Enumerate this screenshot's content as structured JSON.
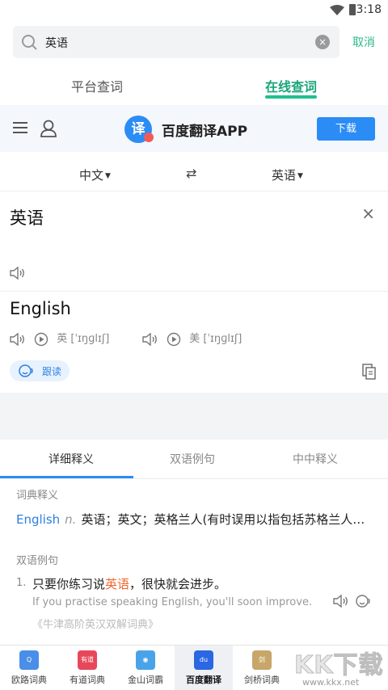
{
  "status_bar": {
    "time": "3:18"
  },
  "search": {
    "query": "英语",
    "cancel_label": "取消"
  },
  "top_tabs": [
    {
      "label": "平台查词",
      "active": false
    },
    {
      "label": "在线查词",
      "active": true
    }
  ],
  "app_banner": {
    "logo_text": "译",
    "app_name": "百度翻译APP",
    "download_label": "下载"
  },
  "lang": {
    "from": "中文",
    "swap": "⇄",
    "to": "英语"
  },
  "source": {
    "word": "英语",
    "close": "×"
  },
  "result": {
    "translation": "English",
    "uk_label": "英 [ˈɪŋɡlɪʃ]",
    "us_label": "美 [ˈɪŋɡlɪʃ]",
    "follow_read": "跟读"
  },
  "detail_tabs": [
    {
      "label": "详细释义",
      "active": true
    },
    {
      "label": "双语例句",
      "active": false
    },
    {
      "label": "中中释义",
      "active": false
    }
  ],
  "dictionary": {
    "section_title": "词典释义",
    "headword": "English",
    "pos": "n.",
    "meaning": "英语；英文；英格兰人(有时误用以指包括苏格兰人…"
  },
  "examples": {
    "section_title": "双语例句",
    "items": [
      {
        "num": "1.",
        "zh_before": "只要你练习说",
        "zh_highlight": "英语",
        "zh_after": "，很快就会进步。",
        "en": "If you practise speaking English, you'll soon improve.",
        "source": "《牛津高阶英汉双解词典》"
      }
    ]
  },
  "bottom_nav": [
    {
      "label": "欧路词典",
      "icon_text": "Q",
      "color": "#4a8ee8",
      "active": false
    },
    {
      "label": "有道词典",
      "icon_text": "有道",
      "color": "#e8475a",
      "active": false
    },
    {
      "label": "金山词霸",
      "icon_text": "◉",
      "color": "#4aa3e8",
      "active": false
    },
    {
      "label": "百度翻译",
      "icon_text": "du",
      "color": "#2b66e3",
      "active": true
    },
    {
      "label": "剑桥词典",
      "icon_text": "剑",
      "color": "#c8a66a",
      "active": false
    }
  ],
  "watermark": {
    "big": "KK下载",
    "small": "www.kkx.net"
  }
}
